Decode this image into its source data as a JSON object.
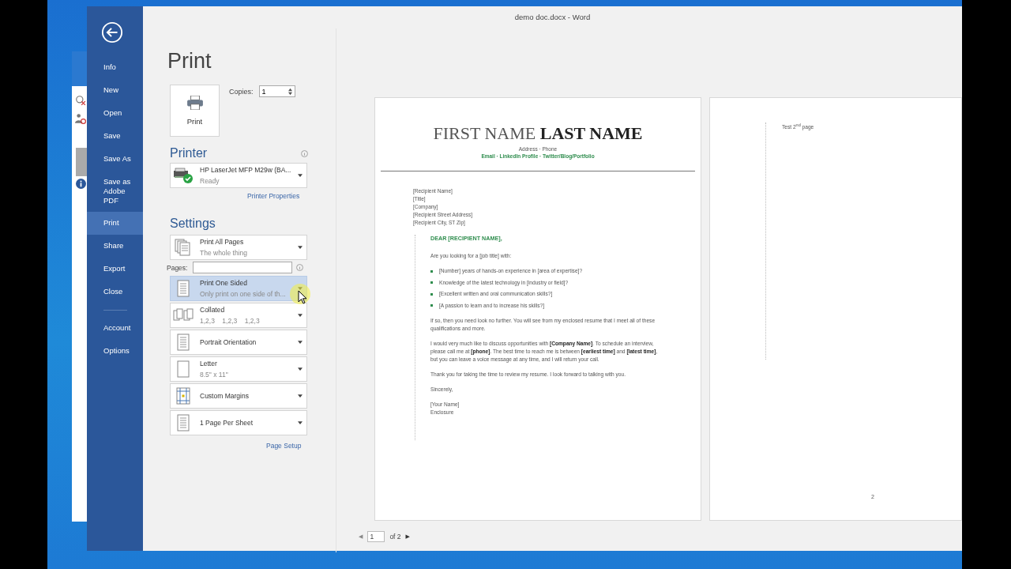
{
  "window": {
    "title": "demo doc.docx - Word"
  },
  "nav": {
    "items": [
      {
        "label": "Info",
        "selected": false
      },
      {
        "label": "New",
        "selected": false
      },
      {
        "label": "Open",
        "selected": false
      },
      {
        "label": "Save",
        "selected": false
      },
      {
        "label": "Save As",
        "selected": false
      },
      {
        "label": "Save as Adobe PDF",
        "selected": false
      },
      {
        "label": "Print",
        "selected": true
      },
      {
        "label": "Share",
        "selected": false
      },
      {
        "label": "Export",
        "selected": false
      },
      {
        "label": "Close",
        "selected": false
      }
    ],
    "bottom_items": [
      {
        "label": "Account",
        "selected": false
      },
      {
        "label": "Options",
        "selected": false
      }
    ]
  },
  "print": {
    "heading": "Print",
    "button": "Print",
    "copies_label": "Copies:",
    "copies": "1"
  },
  "printer": {
    "heading": "Printer",
    "name": "HP LaserJet MFP M29w (BA...",
    "status": "Ready",
    "properties_link": "Printer Properties"
  },
  "settings": {
    "heading": "Settings",
    "pages_label": "Pages:",
    "page_setup_link": "Page Setup",
    "options": [
      {
        "kind": "pages",
        "title": "Print All Pages",
        "subtitle": "The whole thing",
        "highlighted": false
      },
      {
        "kind": "sides",
        "title": "Print One Sided",
        "subtitle": "Only print on one side of th...",
        "highlighted": true
      },
      {
        "kind": "collate",
        "title": "Collated",
        "subtitle": "1,2,3    1,2,3    1,2,3",
        "highlighted": false
      },
      {
        "kind": "orientation",
        "title": "Portrait Orientation",
        "highlighted": false
      },
      {
        "kind": "paper",
        "title": "Letter",
        "subtitle": "8.5\" x 11\"",
        "highlighted": false
      },
      {
        "kind": "margins",
        "title": "Custom Margins",
        "highlighted": false
      },
      {
        "kind": "persheet",
        "title": "1 Page Per Sheet",
        "highlighted": false
      }
    ]
  },
  "preview": {
    "page1": {
      "name_light": "FIRST NAME",
      "name_bold": "LAST NAME",
      "contact": "Address · Phone",
      "links": "Email · LinkedIn Profile · Twitter/Blog/Portfolio",
      "recipient": [
        "[Recipient Name]",
        "[Title]",
        "[Company]",
        "[Recipient Street Address]",
        "[Recipient City, ST Zip]"
      ],
      "salutation": "DEAR [RECIPIENT NAME],",
      "intro": "Are you looking for a [job title] with:",
      "bullets": [
        "[Number] years of hands-on experience in [area of expertise]?",
        "Knowledge of the latest technology in [industry or field]?",
        "[Excellent written and oral communication skills?]",
        "[A passion to learn and to increase his skills?]"
      ],
      "paragraphs": [
        "If so, then you need look no further. You will see from my enclosed resume that I meet all of these qualifications and more.",
        "I would very much like to discuss opportunities with **[Company Name]**. To schedule an interview, please call me at **[phone]**. The best time to reach me is between **[earliest time]** and **[latest time]**, but you can leave a voice message at any time, and I will return your call.",
        "Thank you for taking the time to review my resume. I look forward to talking with you.",
        "Sincerely,"
      ],
      "closing": [
        "[Your Name]",
        "Enclosure"
      ]
    },
    "page2": {
      "text": "Test 2$^{nd}$ page",
      "page_number": "2"
    },
    "pager": {
      "prev": "◀",
      "current": "1",
      "of": "of 2",
      "next": "▶"
    }
  }
}
